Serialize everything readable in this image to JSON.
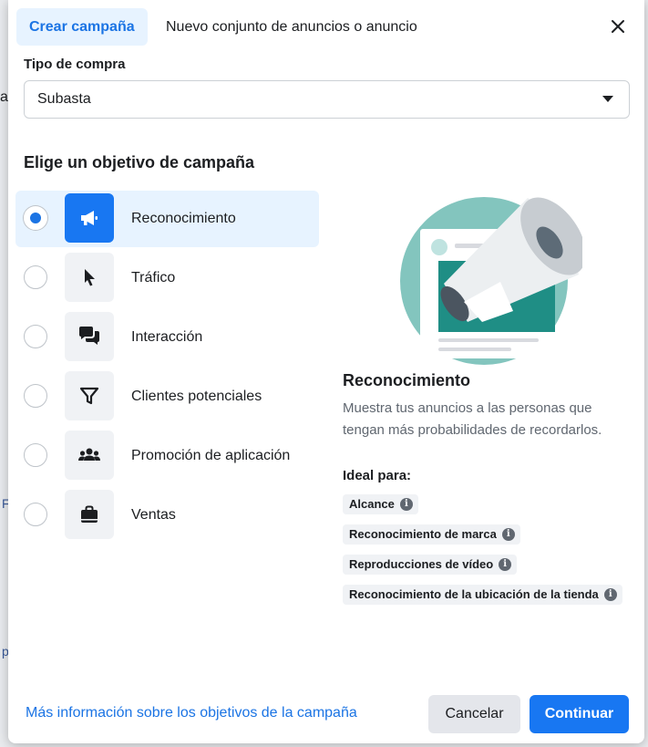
{
  "background": {
    "left_glyph": "ar",
    "left_link_1": "F",
    "left_link_2": "p"
  },
  "tabs": [
    {
      "label": "Crear campaña",
      "active": true
    },
    {
      "label": "Nuevo conjunto de anuncios o anuncio",
      "active": false
    }
  ],
  "purchase_type": {
    "label": "Tipo de compra",
    "value": "Subasta"
  },
  "objectives_title": "Elige un objetivo de campaña",
  "objectives": [
    {
      "label": "Reconocimiento",
      "icon": "megaphone-icon",
      "selected": true
    },
    {
      "label": "Tráfico",
      "icon": "cursor-icon",
      "selected": false
    },
    {
      "label": "Interacción",
      "icon": "chat-bubbles-icon",
      "selected": false
    },
    {
      "label": "Clientes potenciales",
      "icon": "funnel-icon",
      "selected": false
    },
    {
      "label": "Promoción de aplicación",
      "icon": "people-icon",
      "selected": false
    },
    {
      "label": "Ventas",
      "icon": "shopping-bag-icon",
      "selected": false
    }
  ],
  "detail": {
    "title": "Reconocimiento",
    "description": "Muestra tus anuncios a las personas que tengan más probabilidades de recordarlos.",
    "ideal_label": "Ideal para:",
    "tags": [
      "Alcance",
      "Reconocimiento de marca",
      "Reproducciones de vídeo",
      "Reconocimiento de la ubicación de la tienda"
    ]
  },
  "footer": {
    "link": "Más información sobre los objetivos de la campaña",
    "cancel": "Cancelar",
    "continue": "Continuar"
  },
  "colors": {
    "accent": "#1877f2",
    "selected_bg": "#e7f3ff",
    "illustration_teal": "#83c5be"
  }
}
